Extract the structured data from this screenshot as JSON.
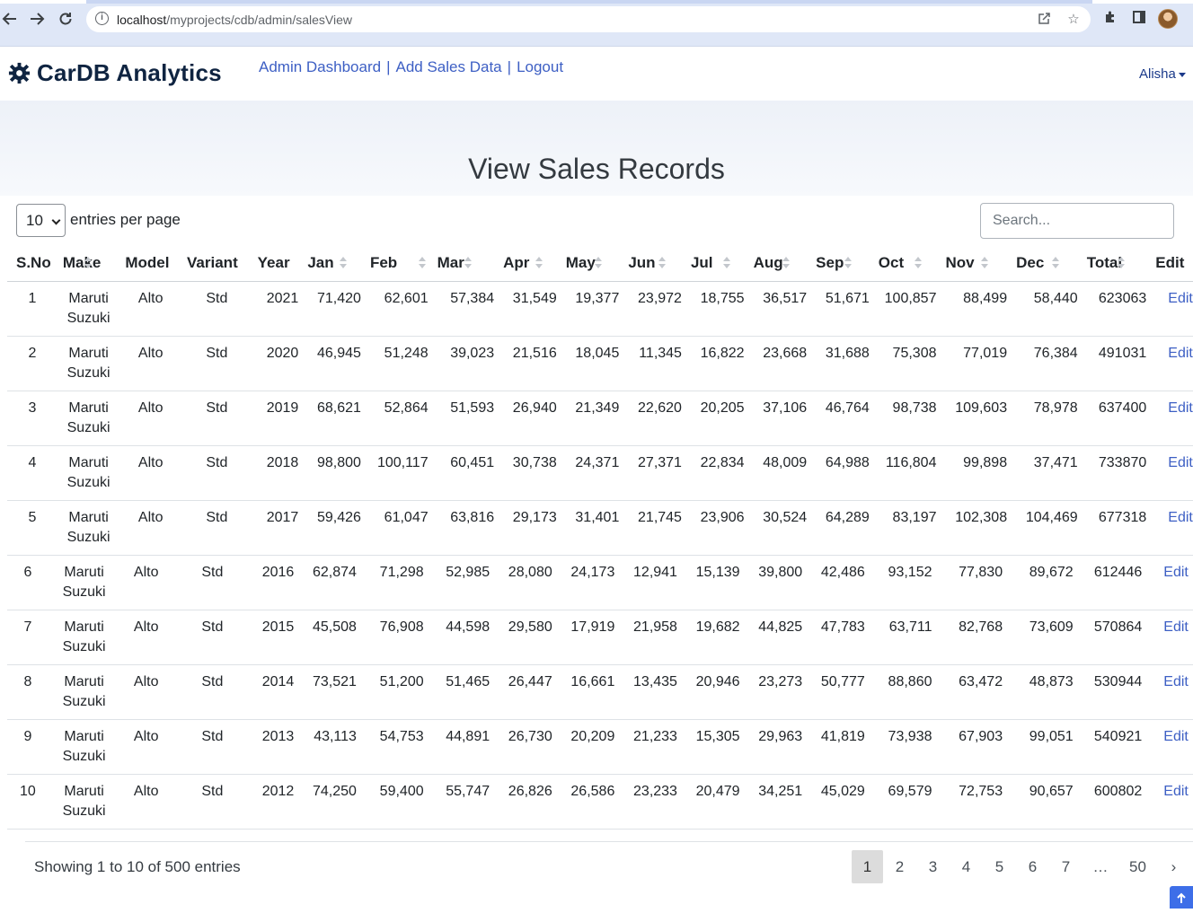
{
  "browser": {
    "url_host": "localhost",
    "url_path": "/myprojects/cdb/admin/salesView",
    "back_icon": "arrow-left-icon",
    "forward_icon": "arrow-right-icon",
    "reload_icon": "reload-icon"
  },
  "navbar": {
    "brand": "CarDB Analytics",
    "links": [
      "Admin Dashboard",
      "Add Sales Data",
      "Logout"
    ],
    "separator": "|",
    "user": "Alisha"
  },
  "hero": {
    "title": "View Sales Records"
  },
  "controls": {
    "page_length": "10",
    "page_length_label": "entries per page",
    "search_placeholder": "Search..."
  },
  "table": {
    "columns": [
      "S.No",
      "Make",
      "Model",
      "Variant",
      "Year",
      "Jan",
      "Feb",
      "Mar",
      "Apr",
      "May",
      "Jun",
      "Jul",
      "Aug",
      "Sep",
      "Oct",
      "Nov",
      "Dec",
      "Total",
      "Edit"
    ],
    "make_line1": "Maruti",
    "make_line2": "Suzuki",
    "rows": [
      {
        "sno": "1",
        "make": [
          "Maruti",
          "Suzuki"
        ],
        "model": "Alto",
        "variant": "Std",
        "year": "2021",
        "jan": "71,420",
        "feb": "62,601",
        "mar": "57,384",
        "apr": "31,549",
        "may": "19,377",
        "jun": "23,972",
        "jul": "18,755",
        "aug": "36,517",
        "sep": "51,671",
        "oct": "100,857",
        "nov": "88,499",
        "dec": "58,440",
        "total": "623063",
        "edit": "Edit"
      },
      {
        "sno": "2",
        "make": [
          "Maruti",
          "Suzuki"
        ],
        "model": "Alto",
        "variant": "Std",
        "year": "2020",
        "jan": "46,945",
        "feb": "51,248",
        "mar": "39,023",
        "apr": "21,516",
        "may": "18,045",
        "jun": "11,345",
        "jul": "16,822",
        "aug": "23,668",
        "sep": "31,688",
        "oct": "75,308",
        "nov": "77,019",
        "dec": "76,384",
        "total": "491031",
        "edit": "Edit"
      },
      {
        "sno": "3",
        "make": [
          "Maruti",
          "Suzuki"
        ],
        "model": "Alto",
        "variant": "Std",
        "year": "2019",
        "jan": "68,621",
        "feb": "52,864",
        "mar": "51,593",
        "apr": "26,940",
        "may": "21,349",
        "jun": "22,620",
        "jul": "20,205",
        "aug": "37,106",
        "sep": "46,764",
        "oct": "98,738",
        "nov": "109,603",
        "dec": "78,978",
        "total": "637400",
        "edit": "Edit"
      },
      {
        "sno": "4",
        "make": [
          "Maruti",
          "Suzuki"
        ],
        "model": "Alto",
        "variant": "Std",
        "year": "2018",
        "jan": "98,800",
        "feb": "100,117",
        "mar": "60,451",
        "apr": "30,738",
        "may": "24,371",
        "jun": "27,371",
        "jul": "22,834",
        "aug": "48,009",
        "sep": "64,988",
        "oct": "116,804",
        "nov": "99,898",
        "dec": "37,471",
        "total": "733870",
        "edit": "Edit"
      },
      {
        "sno": "5",
        "make": [
          "Maruti",
          "Suzuki"
        ],
        "model": "Alto",
        "variant": "Std",
        "year": "2017",
        "jan": "59,426",
        "feb": "61,047",
        "mar": "63,816",
        "apr": "29,173",
        "may": "31,401",
        "jun": "21,745",
        "jul": "23,906",
        "aug": "30,524",
        "sep": "64,289",
        "oct": "83,197",
        "nov": "102,308",
        "dec": "104,469",
        "total": "677318",
        "edit": "Edit"
      },
      {
        "sno": "6",
        "make": [
          "Maruti",
          "Suzuki"
        ],
        "model": "Alto",
        "variant": "Std",
        "year": "2016",
        "jan": "62,874",
        "feb": "71,298",
        "mar": "52,985",
        "apr": "28,080",
        "may": "24,173",
        "jun": "12,941",
        "jul": "15,139",
        "aug": "39,800",
        "sep": "42,486",
        "oct": "93,152",
        "nov": "77,830",
        "dec": "89,672",
        "total": "612446",
        "edit": "Edit"
      },
      {
        "sno": "7",
        "make": [
          "Maruti",
          "Suzuki"
        ],
        "model": "Alto",
        "variant": "Std",
        "year": "2015",
        "jan": "45,508",
        "feb": "76,908",
        "mar": "44,598",
        "apr": "29,580",
        "may": "17,919",
        "jun": "21,958",
        "jul": "19,682",
        "aug": "44,825",
        "sep": "47,783",
        "oct": "63,711",
        "nov": "82,768",
        "dec": "73,609",
        "total": "570864",
        "edit": "Edit"
      },
      {
        "sno": "8",
        "make": [
          "Maruti",
          "Suzuki"
        ],
        "model": "Alto",
        "variant": "Std",
        "year": "2014",
        "jan": "73,521",
        "feb": "51,200",
        "mar": "51,465",
        "apr": "26,447",
        "may": "16,661",
        "jun": "13,435",
        "jul": "20,946",
        "aug": "23,273",
        "sep": "50,777",
        "oct": "88,860",
        "nov": "63,472",
        "dec": "48,873",
        "total": "530944",
        "edit": "Edit"
      },
      {
        "sno": "9",
        "make": [
          "Maruti",
          "Suzuki"
        ],
        "model": "Alto",
        "variant": "Std",
        "year": "2013",
        "jan": "43,113",
        "feb": "54,753",
        "mar": "44,891",
        "apr": "26,730",
        "may": "20,209",
        "jun": "21,233",
        "jul": "15,305",
        "aug": "29,963",
        "sep": "41,819",
        "oct": "73,938",
        "nov": "67,903",
        "dec": "99,051",
        "total": "540921",
        "edit": "Edit"
      },
      {
        "sno": "10",
        "make": [
          "Maruti",
          "Suzuki"
        ],
        "model": "Alto",
        "variant": "Std",
        "year": "2012",
        "jan": "74,250",
        "feb": "59,400",
        "mar": "55,747",
        "apr": "26,826",
        "may": "26,586",
        "jun": "23,233",
        "jul": "20,479",
        "aug": "34,251",
        "sep": "45,029",
        "oct": "69,579",
        "nov": "72,753",
        "dec": "90,657",
        "total": "600802",
        "edit": "Edit"
      }
    ]
  },
  "footer": {
    "info": "Showing 1 to 10 of 500 entries",
    "pages": [
      "1",
      "2",
      "3",
      "4",
      "5",
      "6",
      "7",
      "…",
      "50",
      "›"
    ],
    "active_page": "1"
  }
}
